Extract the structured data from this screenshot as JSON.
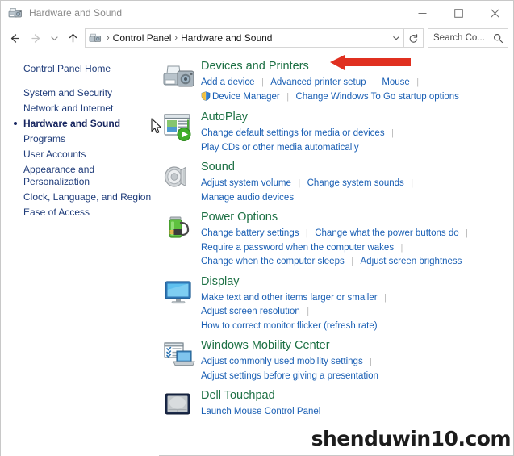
{
  "window": {
    "title": "Hardware and Sound",
    "title_icon": "devices-printers-icon",
    "controls": {
      "minimize": "minimize-button",
      "maximize": "maximize-button",
      "close": "close-button"
    }
  },
  "addressbar": {
    "back": "back-button",
    "forward": "forward-button",
    "recent": "recent-locations-button",
    "up": "up-button",
    "breadcrumb": {
      "icon": "devices-printers-icon",
      "items": [
        "Control Panel",
        "Hardware and Sound"
      ],
      "separator": "›"
    },
    "dropdown": "previous-locations-chevron",
    "refresh": "refresh-button",
    "search": {
      "placeholder": "Search Co...",
      "value": "",
      "icon": "search-icon"
    }
  },
  "sidebar": {
    "home": "Control Panel Home",
    "items": [
      {
        "label": "System and Security",
        "current": false
      },
      {
        "label": "Network and Internet",
        "current": false
      },
      {
        "label": "Hardware and Sound",
        "current": true
      },
      {
        "label": "Programs",
        "current": false
      },
      {
        "label": "User Accounts",
        "current": false
      },
      {
        "label": "Appearance and\nPersonalization",
        "current": false
      },
      {
        "label": "Clock, Language, and Region",
        "current": false
      },
      {
        "label": "Ease of Access",
        "current": false
      }
    ]
  },
  "categories": [
    {
      "title": "Devices and Printers",
      "icon": "devices-printers-icon",
      "rows": [
        [
          {
            "text": "Add a device",
            "shield": false
          },
          {
            "text": "Advanced printer setup",
            "shield": false
          },
          {
            "text": "Mouse",
            "shield": false
          }
        ],
        [
          {
            "text": "Device Manager",
            "shield": true
          },
          {
            "text": "Change Windows To Go startup options",
            "shield": false
          }
        ]
      ]
    },
    {
      "title": "AutoPlay",
      "icon": "autoplay-icon",
      "rows": [
        [
          {
            "text": "Change default settings for media or devices",
            "shield": false
          }
        ],
        [
          {
            "text": "Play CDs or other media automatically",
            "shield": false
          }
        ]
      ]
    },
    {
      "title": "Sound",
      "icon": "sound-icon",
      "rows": [
        [
          {
            "text": "Adjust system volume",
            "shield": false
          },
          {
            "text": "Change system sounds",
            "shield": false
          }
        ],
        [
          {
            "text": "Manage audio devices",
            "shield": false
          }
        ]
      ]
    },
    {
      "title": "Power Options",
      "icon": "power-options-icon",
      "rows": [
        [
          {
            "text": "Change battery settings",
            "shield": false
          },
          {
            "text": "Change what the power buttons do",
            "shield": false
          }
        ],
        [
          {
            "text": "Require a password when the computer wakes",
            "shield": false
          }
        ],
        [
          {
            "text": "Change when the computer sleeps",
            "shield": false
          },
          {
            "text": "Adjust screen brightness",
            "shield": false
          }
        ]
      ]
    },
    {
      "title": "Display",
      "icon": "display-icon",
      "rows": [
        [
          {
            "text": "Make text and other items larger or smaller",
            "shield": false
          }
        ],
        [
          {
            "text": "Adjust screen resolution",
            "shield": false
          }
        ],
        [
          {
            "text": "How to correct monitor flicker (refresh rate)",
            "shield": false
          }
        ]
      ]
    },
    {
      "title": "Windows Mobility Center",
      "icon": "mobility-center-icon",
      "rows": [
        [
          {
            "text": "Adjust commonly used mobility settings",
            "shield": false
          }
        ],
        [
          {
            "text": "Adjust settings before giving a presentation",
            "shield": false
          }
        ]
      ]
    },
    {
      "title": "Dell Touchpad",
      "icon": "touchpad-icon",
      "rows": [
        [
          {
            "text": "Launch Mouse Control Panel",
            "shield": false
          }
        ]
      ]
    }
  ],
  "annotation": {
    "arrow": "red-arrow-annotation",
    "color": "#E03020",
    "points_to": "Devices and Printers"
  },
  "watermark": {
    "text": "shenduwin10.com"
  },
  "colors": {
    "heading_green": "#1D7044",
    "link_blue": "#1A5FB4",
    "sidebar_blue": "#1F3C7A",
    "title_gray": "#8A8A8A"
  }
}
